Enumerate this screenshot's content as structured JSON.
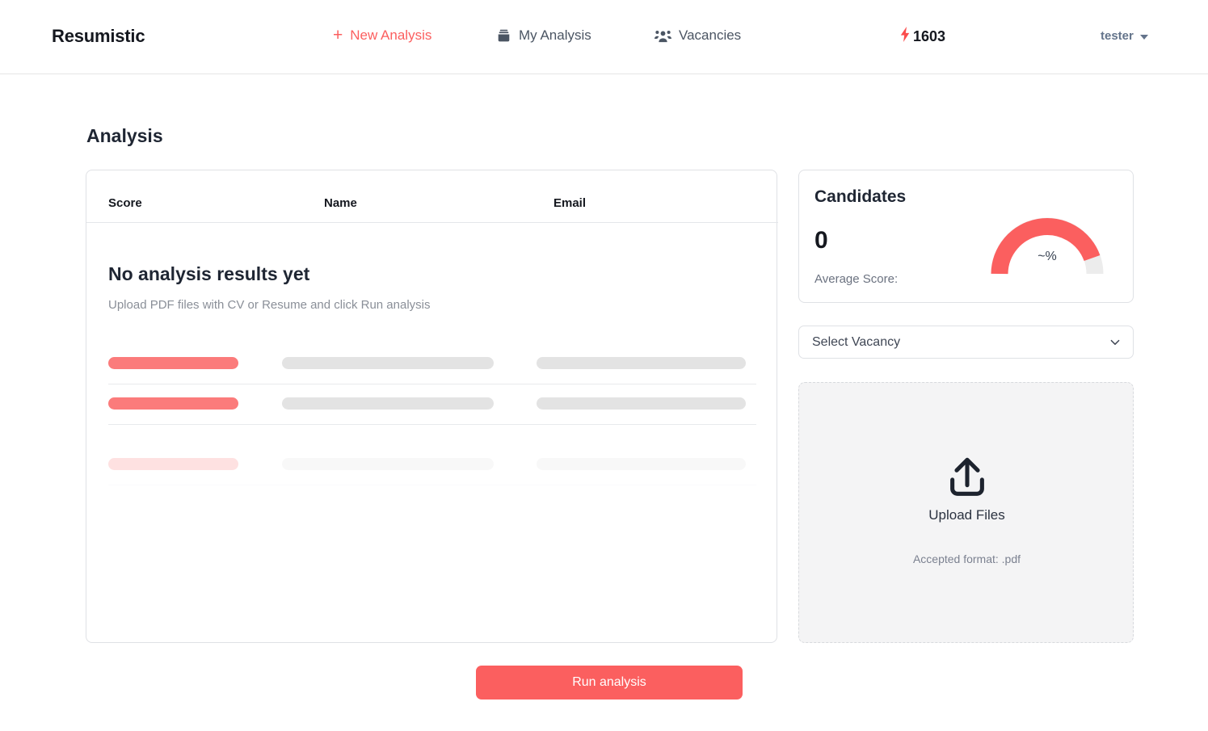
{
  "navbar": {
    "brand": "Resumistic",
    "links": [
      {
        "label": "New Analysis",
        "icon": "plus-icon",
        "active": true
      },
      {
        "label": "My Analysis",
        "icon": "archive-box-icon",
        "active": false
      },
      {
        "label": "Vacancies",
        "icon": "users-group-icon",
        "active": false
      }
    ],
    "credits": {
      "value": "1603",
      "icon": "lightning-bolt-icon"
    },
    "user": {
      "name": "tester",
      "icon": "chevron-down-icon"
    }
  },
  "page": {
    "title": "Analysis"
  },
  "results": {
    "columns": [
      "Score",
      "Name",
      "Email"
    ],
    "empty_title": "No analysis results yet",
    "empty_subtitle": "Upload PDF files with CV or Resume and click Run analysis",
    "skeleton_rows": 3
  },
  "actions": {
    "run_analysis": "Run analysis"
  },
  "candidates": {
    "title": "Candidates",
    "count": "0",
    "average_score_label": "Average Score:",
    "gauge_label": "~%",
    "gauge_percent": 88,
    "gauge_color": "#fb5f5f",
    "gauge_track_color": "#ececec"
  },
  "vacancy": {
    "selected": "Select Vacancy",
    "icon": "chevron-down-icon"
  },
  "upload": {
    "icon": "upload-icon",
    "label": "Upload Files",
    "note": "Accepted format: .pdf"
  },
  "colors": {
    "accent": "#fb5f5f",
    "text": "#15181f",
    "muted": "#8a8f98",
    "border": "#dfe1e5",
    "dropzone_bg": "#f4f4f5"
  }
}
